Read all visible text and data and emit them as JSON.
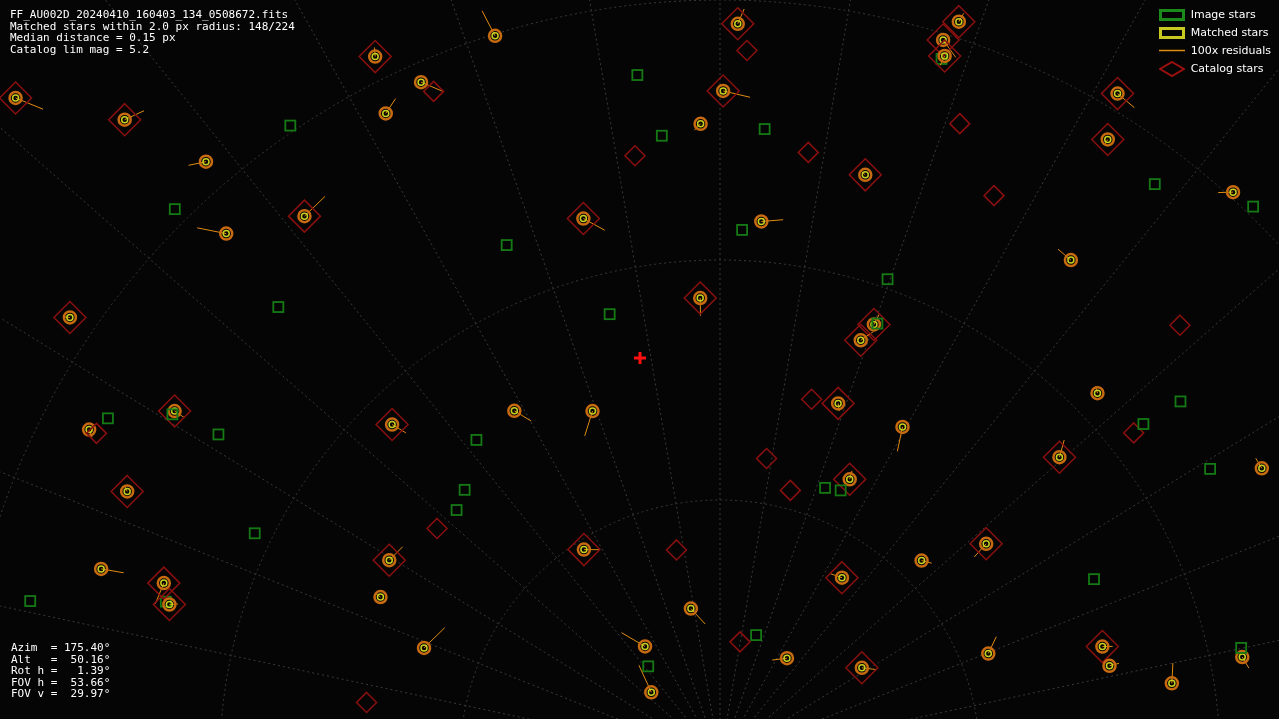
{
  "header": {
    "lines": [
      "FF_AU002D_20240410_160403_134_0508672.fits",
      "Matched stars within 2.0 px radius: 148/224",
      "Median distance = 0.15 px",
      "Catalog lim mag = 5.2"
    ]
  },
  "legend": [
    {
      "kind": "image",
      "label": "Image stars"
    },
    {
      "kind": "matched",
      "label": "Matched stars"
    },
    {
      "kind": "residual",
      "label": "100x residuals"
    },
    {
      "kind": "catalog",
      "label": "Catalog stars"
    }
  ],
  "pointing": [
    "Azim  = 175.40°",
    "Alt   =  50.16°",
    "Rot h =   1.39°",
    "FOV h =  53.66°",
    "FOV v =  29.97°"
  ]
}
